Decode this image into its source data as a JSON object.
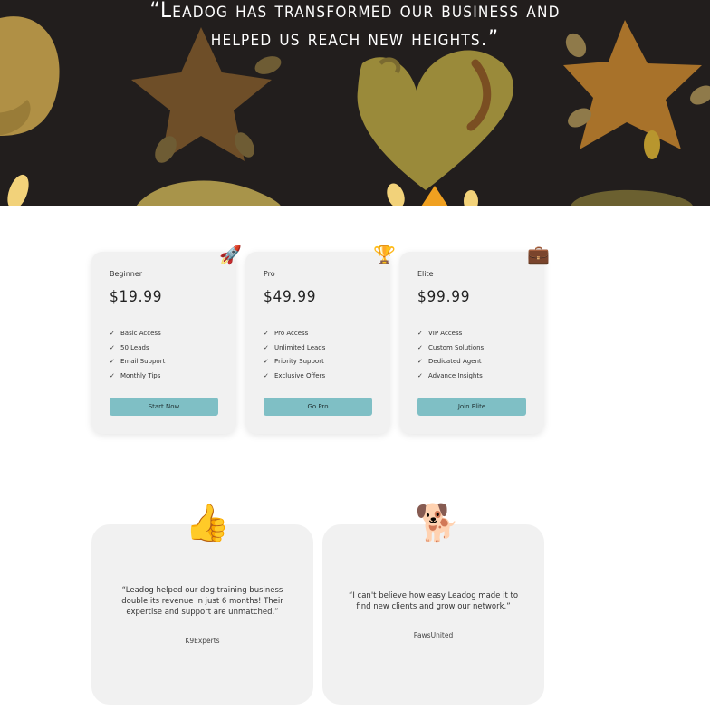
{
  "hero": {
    "quote_line1": "“Leadog has transformed our business and",
    "quote_line2": "helped us reach new heights.”"
  },
  "pricing": [
    {
      "name": "Beginner",
      "price": "$19.99",
      "icon": "rocket-icon",
      "emoji": "🚀",
      "features": [
        "Basic Access",
        "50 Leads",
        "Email Support",
        "Monthly Tips"
      ],
      "button": "Start Now"
    },
    {
      "name": "Pro",
      "price": "$49.99",
      "icon": "trophy-icon",
      "emoji": "🏆",
      "features": [
        "Pro Access",
        "Unlimited Leads",
        "Priority Support",
        "Exclusive Offers"
      ],
      "button": "Go Pro"
    },
    {
      "name": "Elite",
      "price": "$99.99",
      "icon": "briefcase-icon",
      "emoji": "💼",
      "features": [
        "VIP Access",
        "Custom Solutions",
        "Dedicated Agent",
        "Advance Insights"
      ],
      "button": "Join Elite"
    }
  ],
  "check_glyph": "✓",
  "testimonials": [
    {
      "icon": "thumbs-up-icon",
      "emoji": "👍",
      "quote": "“Leadog helped our dog training business double its revenue in just 6 months! Their expertise and support are unmatched.”",
      "author": "K9Experts"
    },
    {
      "icon": "dog-icon",
      "emoji": "🐕",
      "quote": "“I can't believe how easy Leadog made it to find new clients and grow our network.”",
      "author": "PawsUnited"
    }
  ],
  "colors": {
    "hero_bg": "#221e1d",
    "card_bg": "#f1f1f1",
    "button_bg": "#7fbfc5"
  }
}
